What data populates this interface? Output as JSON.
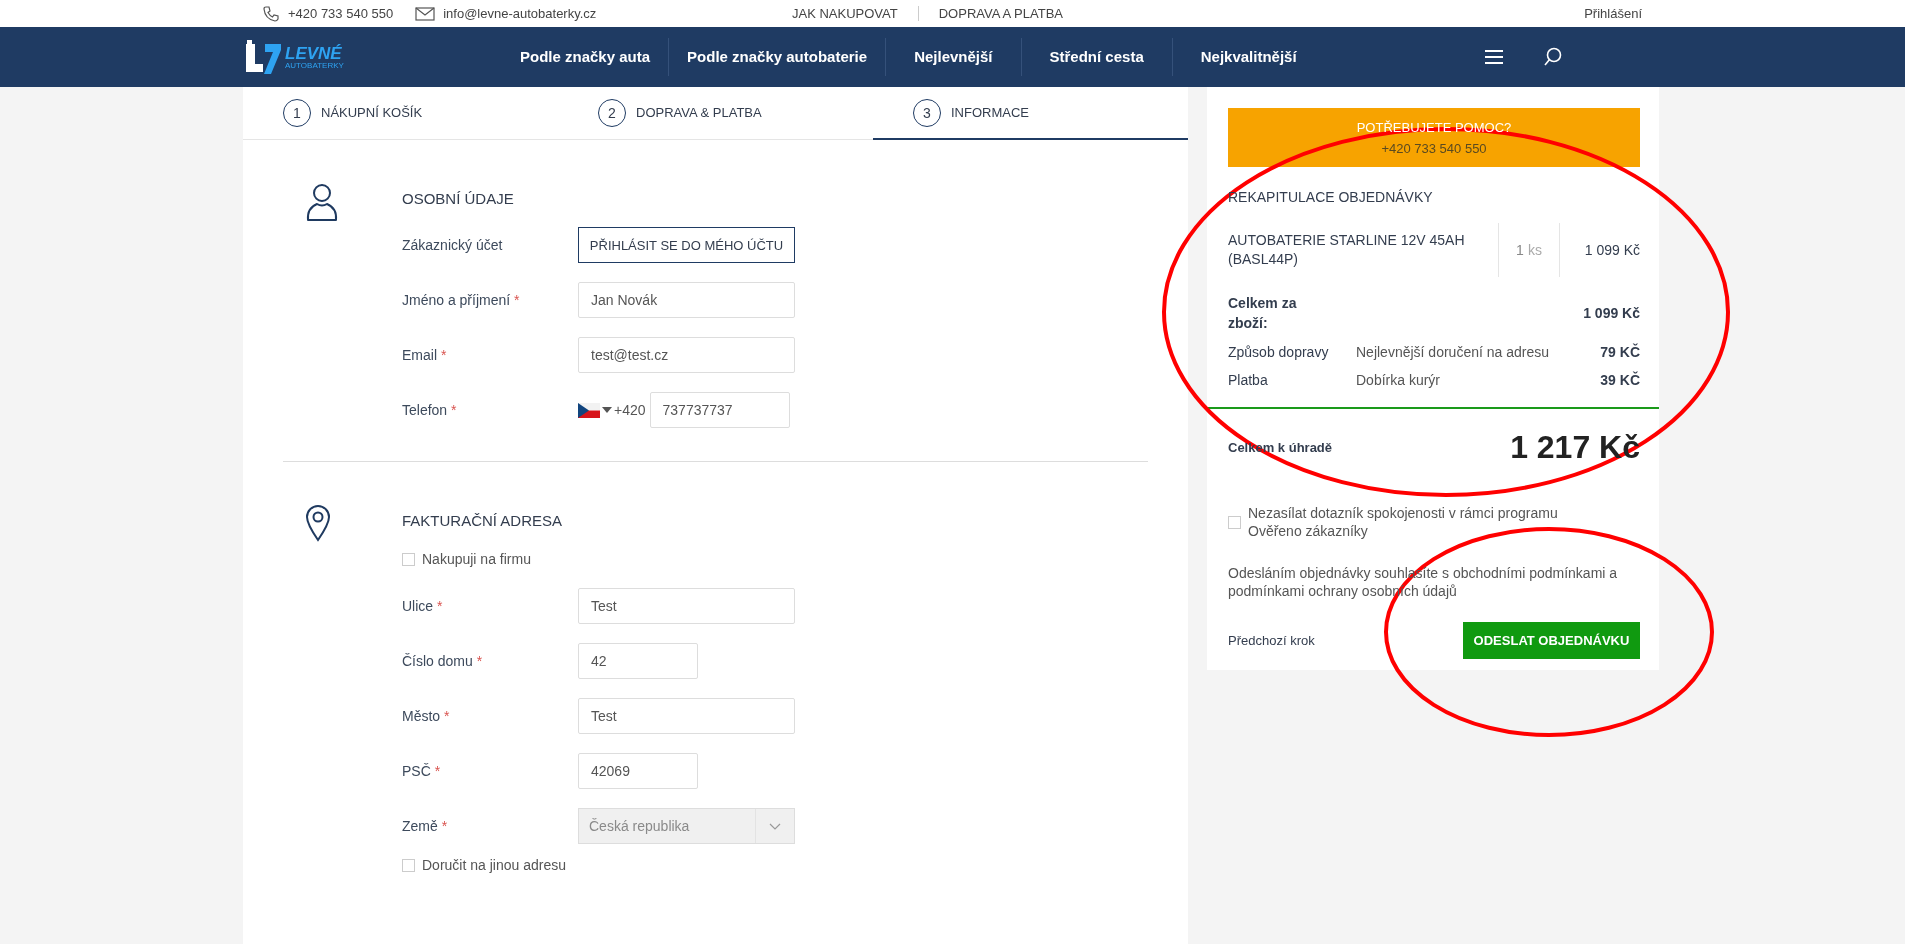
{
  "top_bar": {
    "contacts": [
      {
        "kind": "phone",
        "text": "+420 733 540 550"
      },
      {
        "kind": "email",
        "text": "info@levne-autobaterky.cz"
      }
    ],
    "links": [
      "JAK NAKUPOVAT",
      "DOPRAVA A PLATBA"
    ],
    "login": "Přihlášení"
  },
  "nav": {
    "logo": {
      "text": "LEVNÉ",
      "subtext": "AUTOBATERKY"
    },
    "items": [
      "Podle značky auta",
      "Podle značky autobaterie",
      "Nejlevnější",
      "Střední cesta",
      "Nejkvalitnější"
    ]
  },
  "steps": [
    {
      "number": "1",
      "label": "NÁKUPNÍ KOŠÍK",
      "selected": false
    },
    {
      "number": "2",
      "label": "DOPRAVA & PLATBA",
      "selected": false
    },
    {
      "number": "3",
      "label": "INFORMACE",
      "selected": true
    }
  ],
  "sections": [
    {
      "title": "OSOBNÍ ÚDAJE",
      "rows": [
        {
          "kind": "button",
          "label": "Zákaznický účet",
          "text": "PŘIHLÁSIT SE DO MÉHO ÚČTU"
        },
        {
          "kind": "input",
          "label": "Jméno a příjmení",
          "required_mark": "*",
          "value": "Jan Novák"
        },
        {
          "kind": "input",
          "label": "Email",
          "required_mark": "*",
          "value": "test@test.cz"
        },
        {
          "kind": "phone",
          "label": "Telefon",
          "required_mark": "*",
          "prefix": "+420",
          "value": "737737737"
        }
      ]
    },
    {
      "title": "FAKTURAČNÍ ADRESA",
      "rows": [
        {
          "kind": "checkbox",
          "label": "Nakupuji na firmu",
          "checked": false
        },
        {
          "kind": "input",
          "label": "Ulice",
          "required_mark": "*",
          "value": "Test"
        },
        {
          "kind": "short_input",
          "label": "Číslo domu",
          "required_mark": "*",
          "value": "42"
        },
        {
          "kind": "input",
          "label": "Město",
          "required_mark": "*",
          "value": "Test"
        },
        {
          "kind": "short_input",
          "label": "PSČ",
          "required_mark": "*",
          "value": "42069"
        },
        {
          "kind": "select",
          "label": "Země",
          "required_mark": "*",
          "value": "Česká republika",
          "disabled": true
        },
        {
          "kind": "checkbox",
          "label": "Doručit na jinou adresu",
          "checked": false
        }
      ]
    }
  ],
  "summary": {
    "help": {
      "title": "POTŘEBUJETE POMOC?",
      "phone": "+420 733 540 550"
    },
    "heading": "REKAPITULACE OBJEDNÁVKY",
    "items": [
      {
        "name": "AUTOBATERIE STARLINE 12V 45AH (BASL44P)",
        "qty": "1",
        "unit": "ks",
        "price": "1 099 Kč"
      }
    ],
    "subtotal": {
      "label": "Celkem za zboží:",
      "value": "1 099 Kč"
    },
    "fees": [
      {
        "label": "Způsob dopravy",
        "detail": "Nejlevnější doručení na adresu",
        "value": "79 KČ"
      },
      {
        "label": "Platba",
        "detail": "Dobírka kurýr",
        "value": "39 KČ"
      }
    ],
    "total": {
      "label": "Celkem k úhradě",
      "value": "1 217 Kč"
    },
    "consent": {
      "label": "Nezasílat dotazník spokojenosti v rámci programu Ověřeno zákazníky",
      "checked": false
    },
    "terms": "Odesláním objednávky souhlasíte s obchodními podmínkami a podmínkami ochrany osobních údajů",
    "back": "Předchozí krok",
    "submit": "ODESLAT OBJEDNÁVKU"
  },
  "annotations": [
    {
      "kind": "ellipse"
    },
    {
      "kind": "ellipse"
    }
  ]
}
